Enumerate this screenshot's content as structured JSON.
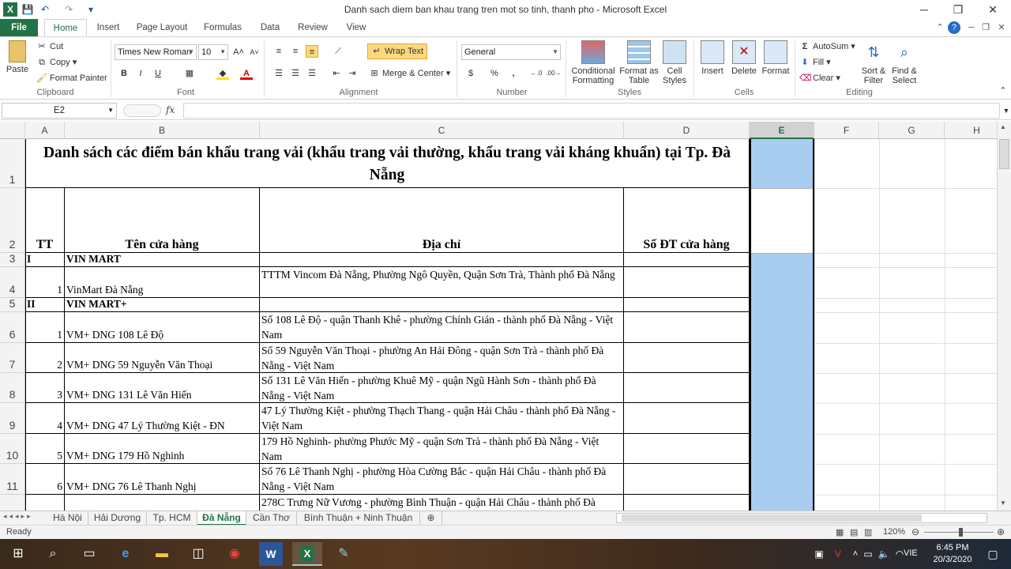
{
  "window": {
    "title": "Danh sach diem ban khau trang tren mot so tinh, thanh pho  -  Microsoft Excel",
    "minimize": "─",
    "restore": "❐",
    "close": "✕"
  },
  "qat": {
    "excel_logo": "X",
    "save": "💾",
    "undo": "↶",
    "redo": "↷",
    "customize": "▾"
  },
  "tabs": [
    "File",
    "Home",
    "Insert",
    "Page Layout",
    "Formulas",
    "Data",
    "Review",
    "View"
  ],
  "ribbon": {
    "clipboard": {
      "paste": "Paste",
      "cut": "Cut",
      "copy": "Copy",
      "format_painter": "Format Painter",
      "label": "Clipboard"
    },
    "font": {
      "name": "Times New Roman",
      "size": "10",
      "bold": "B",
      "italic": "I",
      "underline": "U",
      "grow": "A˄",
      "shrink": "A˅",
      "label": "Font"
    },
    "alignment": {
      "wrap_text": "Wrap Text",
      "merge_center": "Merge & Center",
      "label": "Alignment"
    },
    "number": {
      "format": "General",
      "currency": "$",
      "percent": "%",
      "comma": ",",
      "inc_decimal": "←.0",
      "dec_decimal": ".00→",
      "label": "Number"
    },
    "styles": {
      "conditional": "Conditional Formatting",
      "format_table": "Format as Table",
      "cell_styles": "Cell Styles",
      "label": "Styles"
    },
    "cells": {
      "insert": "Insert",
      "delete": "Delete",
      "format": "Format",
      "label": "Cells"
    },
    "editing": {
      "autosum": "AutoSum",
      "fill": "Fill",
      "clear": "Clear",
      "sort_filter": "Sort & Filter",
      "find_select": "Find & Select",
      "label": "Editing"
    }
  },
  "formula_bar": {
    "name_box": "E2",
    "fx": "fx",
    "value": ""
  },
  "columns": [
    "A",
    "B",
    "C",
    "D",
    "E",
    "F",
    "G",
    "H"
  ],
  "rows": [
    {
      "num": "1"
    },
    {
      "num": "2"
    },
    {
      "num": "3"
    },
    {
      "num": "4"
    },
    {
      "num": "5"
    },
    {
      "num": "6"
    },
    {
      "num": "7"
    },
    {
      "num": "8"
    },
    {
      "num": "9"
    },
    {
      "num": "10"
    },
    {
      "num": "11"
    },
    {
      "num": "12"
    }
  ],
  "sheet": {
    "title": "Danh sách các điểm bán khẩu trang vải (khẩu trang vải thường, khẩu trang vải kháng khuẩn) tại Tp. Đà Nẵng",
    "header": {
      "tt": "TT",
      "name": "Tên cửa hàng",
      "address": "Địa chỉ",
      "phone": "Số ĐT cửa hàng"
    },
    "r3": {
      "a": "I",
      "b": "VIN MART"
    },
    "r4": {
      "a": "1",
      "b": "VinMart Đà Nẵng",
      "c": "TTTM Vincom Đà Nẵng, Phường Ngô Quyền, Quận Sơn Trà, Thành phố Đà Nẵng"
    },
    "r5": {
      "a": "II",
      "b": "VIN MART+"
    },
    "r6": {
      "a": "1",
      "b": "VM+ DNG 108 Lê Độ",
      "c": "Số 108 Lê Độ - quận Thanh Khê - phường Chính Gián - thành phố Đà Nẵng - Việt Nam"
    },
    "r7": {
      "a": "2",
      "b": "VM+ DNG 59 Nguyễn Văn Thoại",
      "c": "Số 59 Nguyễn Văn Thoại - phường An Hải Đông - quận Sơn Trà - thành phố Đà Nẵng - Việt Nam"
    },
    "r8": {
      "a": "3",
      "b": "VM+ DNG 131 Lê Văn Hiến",
      "c": "Số 131 Lê Văn Hiến - phường Khuê Mỹ - quận Ngũ Hành Sơn - thành phố Đà Nẵng - Việt Nam"
    },
    "r9": {
      "a": "4",
      "b": "VM+ DNG 47 Lý Thường Kiệt - ĐN",
      "c": "47 Lý Thường Kiệt - phường Thạch Thang - quận Hải Châu - thành phố Đà Nẵng - Việt Nam"
    },
    "r10": {
      "a": "5",
      "b": "VM+ DNG 179 Hồ Nghinh",
      "c": "179 Hồ Nghinh- phường Phước Mỹ - quận Sơn Trà - thành phố Đà Nẵng - Việt Nam"
    },
    "r11": {
      "a": "6",
      "b": "VM+ DNG 76 Lê Thanh Nghị",
      "c": "Số 76 Lê Thanh Nghị - phường Hòa Cường Bắc - quận Hải Châu - thành phố Đà Nẵng - Việt Nam"
    },
    "r12": {
      "c": "278C Trưng Nữ Vương - phường Bình Thuận - quận Hải Châu - thành phố Đà"
    }
  },
  "sheet_tabs": [
    "Hà Nội",
    "Hải Dương",
    "Tp. HCM",
    "Đà Nẵng",
    "Cần Thơ",
    "Bình Thuận + Ninh Thuận"
  ],
  "active_sheet": "Đà Nẵng",
  "status": {
    "ready": "Ready",
    "zoom": "120%"
  },
  "taskbar": {
    "lang": "VIE",
    "time": "6:45 PM",
    "date": "20/3/2020"
  },
  "colors": {
    "excel_green": "#217346",
    "selection": "#a9cdf0"
  }
}
